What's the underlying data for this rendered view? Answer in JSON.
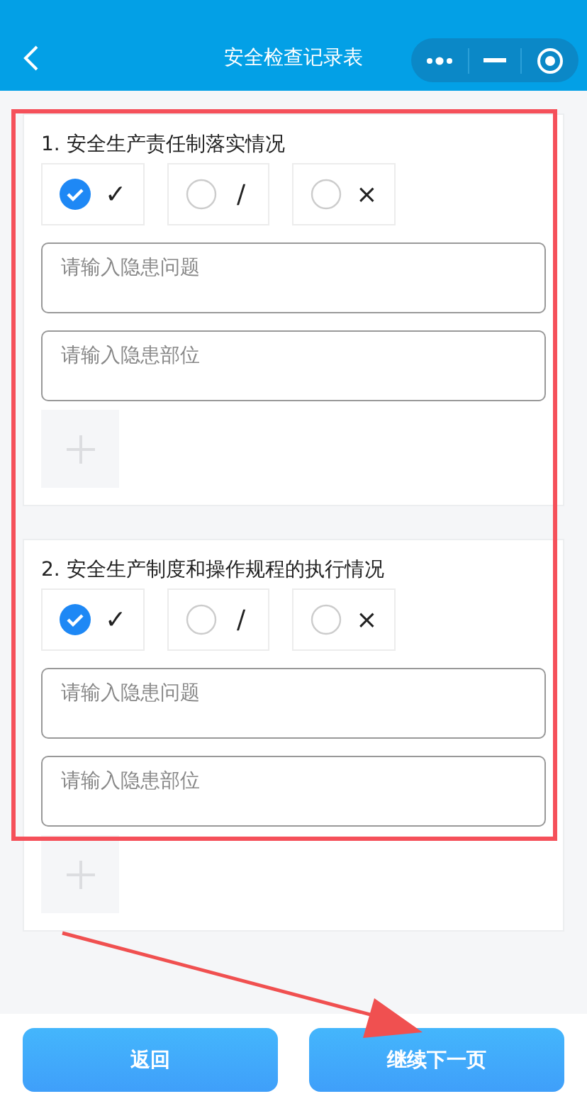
{
  "header": {
    "title": "安全检查记录表"
  },
  "sections": [
    {
      "title": "1. 安全生产责任制落实情况",
      "options": [
        {
          "label": "✓",
          "selected": true
        },
        {
          "label": "/",
          "selected": false
        },
        {
          "label": "×",
          "selected": false
        }
      ],
      "fields": [
        {
          "placeholder": "请输入隐患问题"
        },
        {
          "placeholder": "请输入隐患部位"
        }
      ]
    },
    {
      "title": "2. 安全生产制度和操作规程的执行情况",
      "options": [
        {
          "label": "✓",
          "selected": true
        },
        {
          "label": "/",
          "selected": false
        },
        {
          "label": "×",
          "selected": false
        }
      ],
      "fields": [
        {
          "placeholder": "请输入隐患问题"
        },
        {
          "placeholder": "请输入隐患部位"
        }
      ]
    }
  ],
  "buttons": [
    "返回",
    "继续下一页"
  ]
}
